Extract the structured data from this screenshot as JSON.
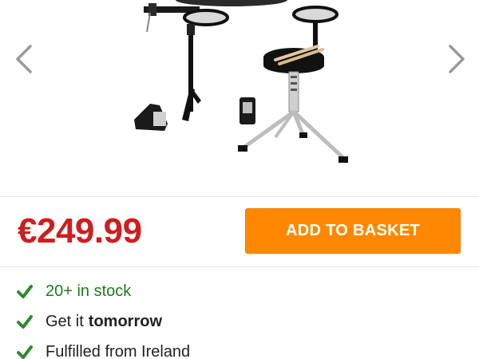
{
  "gallery": {
    "image_icon": "drum-kit-product-image",
    "prev_icon": "chevron-left-icon",
    "next_icon": "chevron-right-icon"
  },
  "product": {
    "price": "€249.99",
    "add_to_basket_label": "ADD TO BASKET"
  },
  "features": [
    {
      "text": "20+ in stock",
      "icon": "check-icon"
    },
    {
      "text": "Get it",
      "emphasis": "tomorrow",
      "icon": "check-icon"
    },
    {
      "text": "Fulfilled from Ireland",
      "icon": "check-icon"
    }
  ],
  "colors": {
    "price": "#cc1f1f",
    "button": "#ff8800",
    "check": "#2e8b2e",
    "stock_text": "#1e7a1e"
  }
}
